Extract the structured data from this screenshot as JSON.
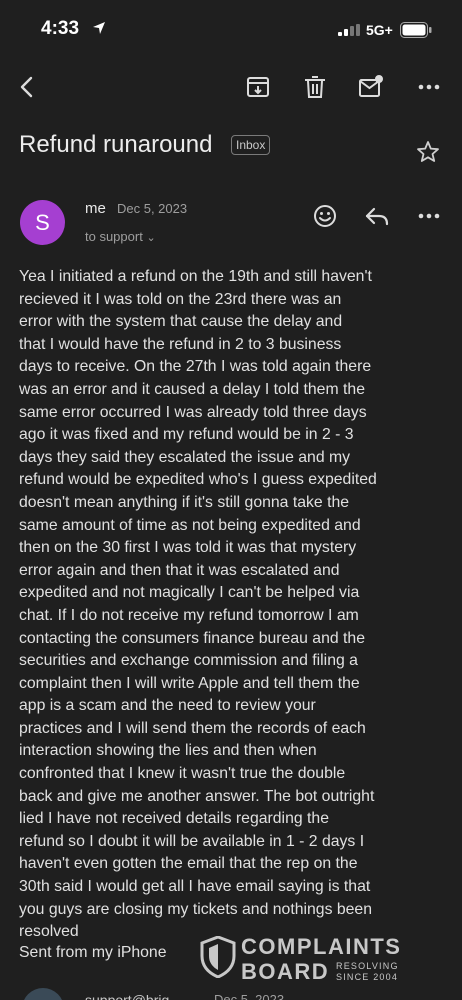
{
  "status_bar": {
    "time": "4:33",
    "network": "5G+"
  },
  "icons": {
    "location": "location-arrow-icon",
    "signal": "cellular-signal-icon",
    "battery": "battery-icon",
    "back": "back-arrow-icon",
    "archive": "archive-icon",
    "delete": "trash-icon",
    "mark_unread": "mark-unread-icon",
    "more": "more-horizontal-icon",
    "star": "star-icon",
    "react": "emoji-react-icon",
    "reply": "reply-icon"
  },
  "email": {
    "subject": "Refund runaround",
    "label_chip": "Inbox",
    "avatar_letter": "S",
    "sender": "me",
    "date": "Dec 5, 2023",
    "recipient": "to support",
    "body": "Yea I initiated a refund on the 19th and still haven't\nrecieved it I was told on the 23rd there was an\nerror with the system that  cause the delay and\nthat I would have the refund in 2 to 3 business\ndays to receive. On the 27th I was told again there\nwas an error and it caused a delay I told them the\nsame error occurred I was already told three days\nago it was fixed and my refund would be in 2 - 3\ndays they said they escalated the issue and my\nrefund would be expedited who's I guess expedited\ndoesn't mean anything if it's still gonna take the\nsame amount of time as not being expedited and\nthen on the 30 first I was told it was that mystery\nerror again and then that it was escalated and\nexpedited and not magically I can't be helped via\nchat. If I do not receive my refund tomorrow I am\ncontacting the consumers finance bureau and the\nsecurities and exchange commission and filing a\ncomplaint then I will write Apple and tell them the\napp is a scam and the need to review your\npractices and I will send them the records of each\ninteraction showing the lies and then when\nconfronted that I knew it wasn't true the double\nback and give me another answer. The bot outright\nlied I have not received details regarding the\nrefund so I doubt it will be available in 1 - 2 days I\nhaven't even gotten the email that the rep on the\n30th said I would get all I have email saying is that\nyou guys are closing my tickets and nothings been\nresolved",
    "signature": "Sent from my iPhone"
  },
  "watermark": {
    "line1": "COMPLAINTS",
    "line2": "BOARD",
    "tagline1": "RESOLVING",
    "tagline2": "SINCE 2004"
  },
  "next_message": {
    "sender": "support@brig",
    "date": "Dec 5, 2023"
  },
  "colors": {
    "background": "#1f1f1f",
    "avatar": "#a53fd1",
    "text": "#e3e3e3",
    "muted": "#9e9e9e"
  }
}
